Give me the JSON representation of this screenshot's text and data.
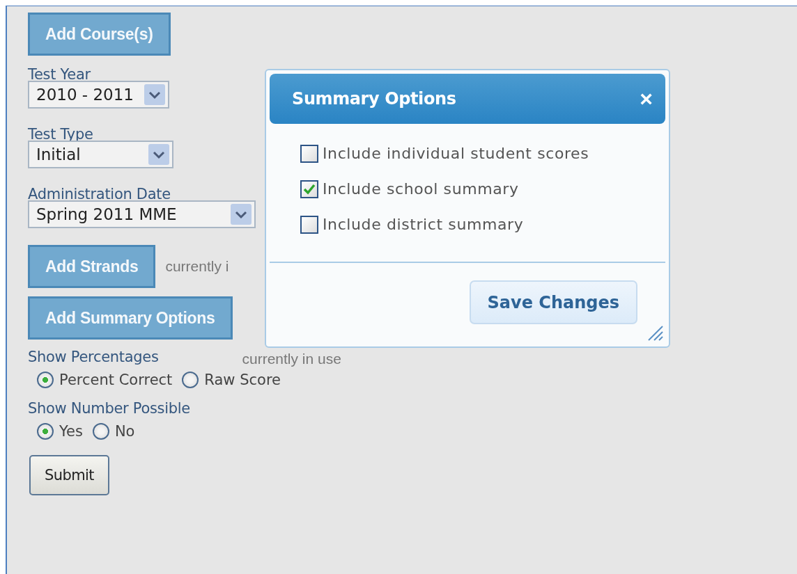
{
  "form": {
    "add_course_button": "Add Course(s)",
    "selects": [
      {
        "label": "Test Year",
        "value": "2010 - 2011"
      },
      {
        "label": "Test Type",
        "value": "Initial"
      },
      {
        "label": "Administration Date",
        "value": "Spring 2011 MME"
      }
    ],
    "strands": {
      "button": "Add Strands",
      "status": "currently i"
    },
    "summary": {
      "button": "Add Summary Options",
      "status": "currently in use"
    },
    "radio_groups": [
      {
        "label": "Show Percentages",
        "options": [
          {
            "label": "Percent Correct",
            "selected": true
          },
          {
            "label": "Raw Score",
            "selected": false
          }
        ]
      },
      {
        "label": "Show Number Possible",
        "options": [
          {
            "label": "Yes",
            "selected": true
          },
          {
            "label": "No",
            "selected": false
          }
        ]
      }
    ],
    "submit_button": "Submit"
  },
  "dialog": {
    "title": "Summary Options",
    "close": "×",
    "options": [
      {
        "label": "Include individual student scores",
        "checked": false
      },
      {
        "label": "Include school summary",
        "checked": true
      },
      {
        "label": "Include district summary",
        "checked": false
      }
    ],
    "save_button": "Save Changes"
  }
}
